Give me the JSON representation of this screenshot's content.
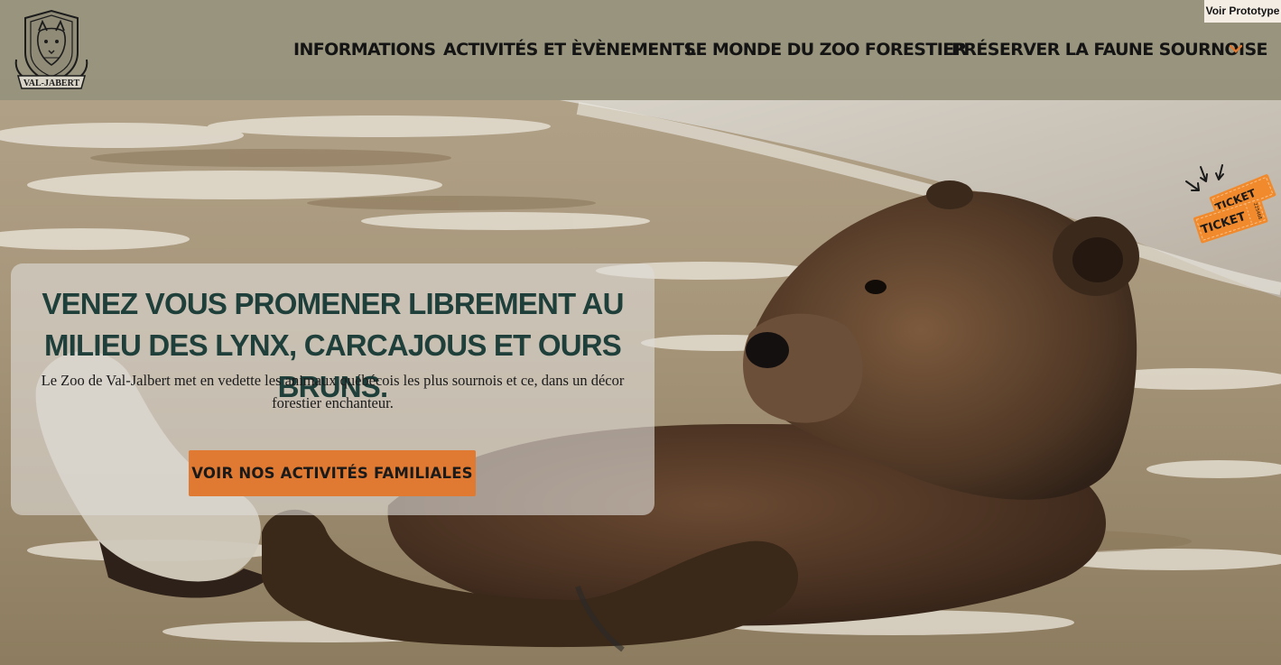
{
  "header": {
    "logo_text": "VAL-JABERT",
    "nav": [
      {
        "label": "INFORMATIONS"
      },
      {
        "label": "ACTIVITÉS ET ÈVÈNEMENTS"
      },
      {
        "label": "LE MONDE DU ZOO FORESTIER"
      },
      {
        "label": "PRÉSERVER LA FAUNE SOURNOISE"
      }
    ],
    "prototype_button": "Voir Prototype"
  },
  "hero": {
    "title": "VENEZ VOUS PROMENER LIBREMENT AU MILIEU DES LYNX, CARCAJOUS ET OURS BRUNS.",
    "description": "Le Zoo de Val-Jalbert met en vedette les animaux québécois les plus sournois et ce, dans un décor forestier enchanteur.",
    "cta_label": "VOIR NOS ACTIVITÉS FAMILIALES"
  },
  "ticket": {
    "label_front": "TICKET",
    "label_back": "TICKET",
    "serial": "225468"
  },
  "colors": {
    "header_bg": "#96927c",
    "accent_orange": "#e07a32",
    "title_green": "#1f3f3a",
    "ticket_orange": "#f08a2c"
  }
}
